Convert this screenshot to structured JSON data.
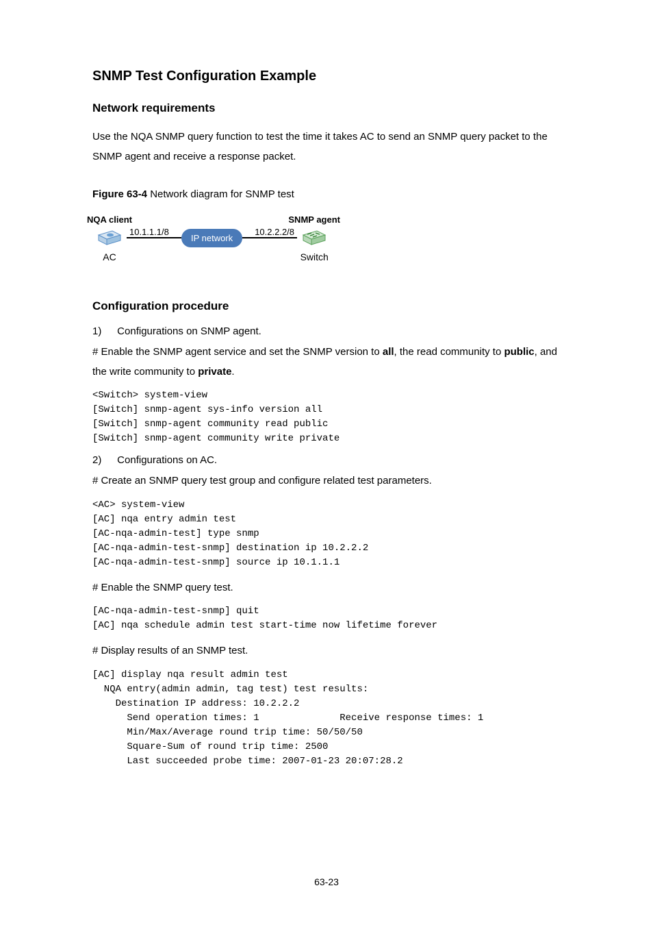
{
  "section_title": "SNMP Test Configuration Example",
  "net_req_title": "Network requirements",
  "net_req_body": "Use the NQA SNMP query function to test the time it takes AC to send an SNMP query packet to the SNMP agent and receive a response packet.",
  "figure": {
    "label": "Figure 63-4",
    "caption": "Network diagram for SNMP test"
  },
  "diagram": {
    "left_top_label": "NQA client",
    "left_ip": "10.1.1.1/8",
    "left_bottom_label": "AC",
    "middle_label": "IP network",
    "right_top_label": "SNMP agent",
    "right_ip": "10.2.2.2/8",
    "right_bottom_label": "Switch"
  },
  "config_proc_title": "Configuration procedure",
  "step1": {
    "marker": "1)",
    "text": "Configurations on SNMP agent."
  },
  "step1_hash_prefix": "# Enable the SNMP agent service and set the SNMP version to ",
  "step1_hash_bold1": "all",
  "step1_hash_mid1": ", the read community to ",
  "step1_hash_bold2": "public",
  "step1_hash_mid2": ", and the write community to ",
  "step1_hash_bold3": "private",
  "step1_hash_end": ".",
  "code1": [
    "<Switch> system-view",
    "[Switch] snmp-agent sys-info version all",
    "[Switch] snmp-agent community read public",
    "[Switch] snmp-agent community write private"
  ],
  "step2": {
    "marker": "2)",
    "text": "Configurations on AC."
  },
  "step2_hash": "# Create an SNMP query test group and configure related test parameters.",
  "code2": [
    "<AC> system-view",
    "[AC] nqa entry admin test",
    "[AC-nqa-admin-test] type snmp",
    "[AC-nqa-admin-test-snmp] destination ip 10.2.2.2",
    "[AC-nqa-admin-test-snmp] source ip 10.1.1.1"
  ],
  "step3_hash": "# Enable the SNMP query test.",
  "code3": [
    "[AC-nqa-admin-test-snmp] quit",
    "[AC] nqa schedule admin test start-time now lifetime forever"
  ],
  "step4_hash": "# Display results of an SNMP test.",
  "code4": [
    "[AC] display nqa result admin test",
    "  NQA entry(admin admin, tag test) test results:",
    "    Destination IP address: 10.2.2.2",
    "      Send operation times: 1              Receive response times: 1",
    "      Min/Max/Average round trip time: 50/50/50",
    "      Square-Sum of round trip time: 2500",
    "      Last succeeded probe time: 2007-01-23 20:07:28.2"
  ],
  "page_number": "63-23"
}
